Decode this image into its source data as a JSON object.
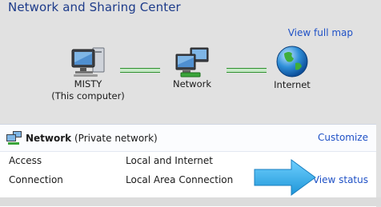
{
  "header": {
    "title": "Network and Sharing Center",
    "view_full_map": "View full map"
  },
  "map": {
    "computer": {
      "name": "MISTY",
      "sub": "(This computer)"
    },
    "network": {
      "label": "Network"
    },
    "internet": {
      "label": "Internet"
    }
  },
  "network_panel": {
    "name": "Network",
    "type": "(Private network)",
    "customize": "Customize",
    "rows": [
      {
        "label": "Access",
        "value": "Local and Internet"
      },
      {
        "label": "Connection",
        "value": "Local Area Connection",
        "action": "View status"
      }
    ]
  },
  "colors": {
    "link": "#1f51c6",
    "title": "#1d3b8a",
    "arrow": "#2aa9e6"
  }
}
